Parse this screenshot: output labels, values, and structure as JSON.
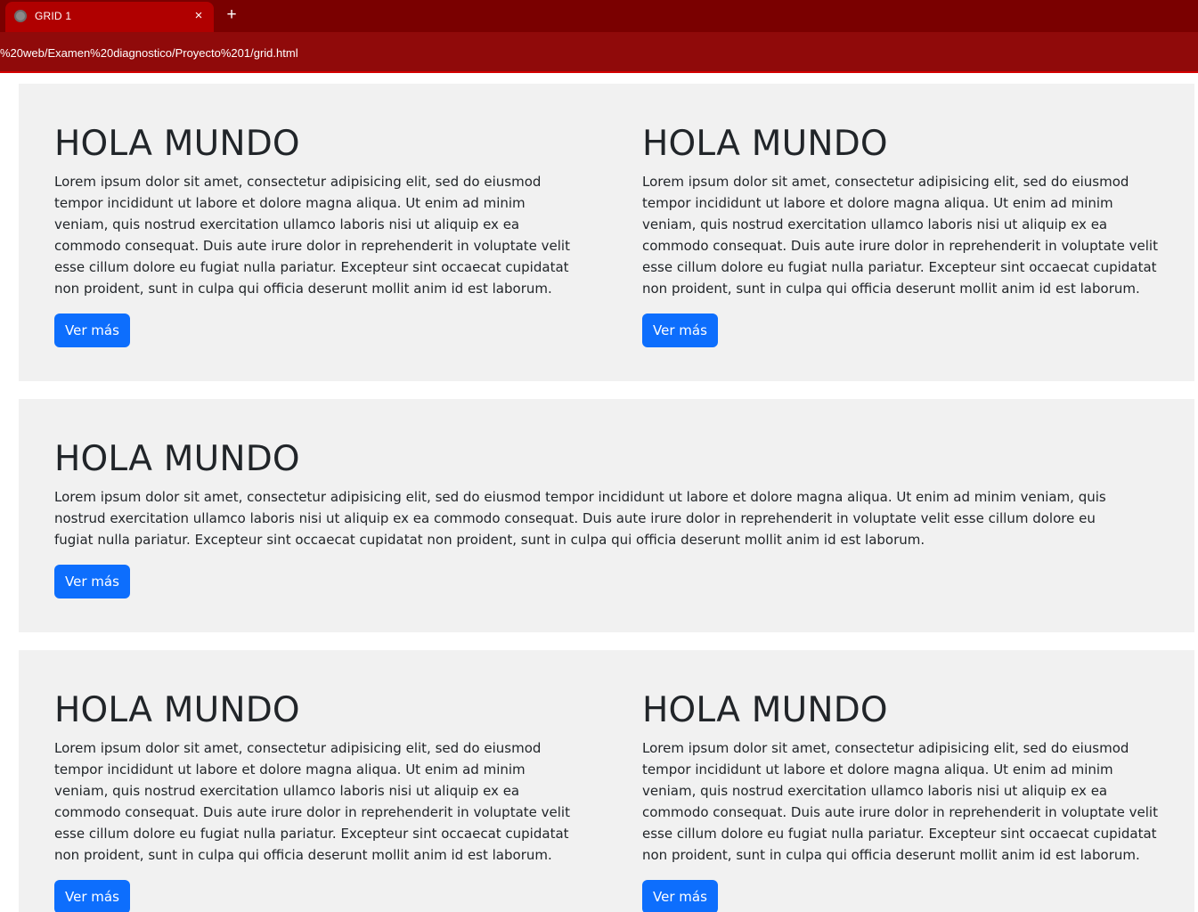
{
  "browser": {
    "tab_title": "GRID 1",
    "close_glyph": "×",
    "new_tab_glyph": "+",
    "url": "%20web/Examen%20diagnostico/Proyecto%201/grid.html"
  },
  "sections": [
    {
      "columns": [
        {
          "heading": "HOLA MUNDO",
          "text": "Lorem ipsum dolor sit amet, consectetur adipisicing elit, sed do eiusmod tempor incididunt ut labore et dolore magna aliqua. Ut enim ad minim veniam, quis nostrud exercitation ullamco laboris nisi ut aliquip ex ea commodo consequat. Duis aute irure dolor in reprehenderit in voluptate velit esse cillum dolore eu fugiat nulla pariatur. Excepteur sint occaecat cupidatat non proident, sunt in culpa qui officia deserunt mollit anim id est laborum.",
          "button": "Ver más"
        },
        {
          "heading": "HOLA MUNDO",
          "text": "Lorem ipsum dolor sit amet, consectetur adipisicing elit, sed do eiusmod tempor incididunt ut labore et dolore magna aliqua. Ut enim ad minim veniam, quis nostrud exercitation ullamco laboris nisi ut aliquip ex ea commodo consequat. Duis aute irure dolor in reprehenderit in voluptate velit esse cillum dolore eu fugiat nulla pariatur. Excepteur sint occaecat cupidatat non proident, sunt in culpa qui officia deserunt mollit anim id est laborum.",
          "button": "Ver más"
        }
      ]
    },
    {
      "columns": [
        {
          "heading": "HOLA MUNDO",
          "text": "Lorem ipsum dolor sit amet, consectetur adipisicing elit, sed do eiusmod tempor incididunt ut labore et dolore magna aliqua. Ut enim ad minim veniam, quis nostrud exercitation ullamco laboris nisi ut aliquip ex ea commodo consequat. Duis aute irure dolor in reprehenderit in voluptate velit esse cillum dolore eu fugiat nulla pariatur. Excepteur sint occaecat cupidatat non proident, sunt in culpa qui officia deserunt mollit anim id est laborum.",
          "button": "Ver más"
        }
      ]
    },
    {
      "columns": [
        {
          "heading": "HOLA MUNDO",
          "text": "Lorem ipsum dolor sit amet, consectetur adipisicing elit, sed do eiusmod tempor incididunt ut labore et dolore magna aliqua. Ut enim ad minim veniam, quis nostrud exercitation ullamco laboris nisi ut aliquip ex ea commodo consequat. Duis aute irure dolor in reprehenderit in voluptate velit esse cillum dolore eu fugiat nulla pariatur. Excepteur sint occaecat cupidatat non proident, sunt in culpa qui officia deserunt mollit anim id est laborum.",
          "button": "Ver más"
        },
        {
          "heading": "HOLA MUNDO",
          "text": "Lorem ipsum dolor sit amet, consectetur adipisicing elit, sed do eiusmod tempor incididunt ut labore et dolore magna aliqua. Ut enim ad minim veniam, quis nostrud exercitation ullamco laboris nisi ut aliquip ex ea commodo consequat. Duis aute irure dolor in reprehenderit in voluptate velit esse cillum dolore eu fugiat nulla pariatur. Excepteur sint occaecat cupidatat non proident, sunt in culpa qui officia deserunt mollit anim id est laborum.",
          "button": "Ver más"
        }
      ]
    }
  ]
}
